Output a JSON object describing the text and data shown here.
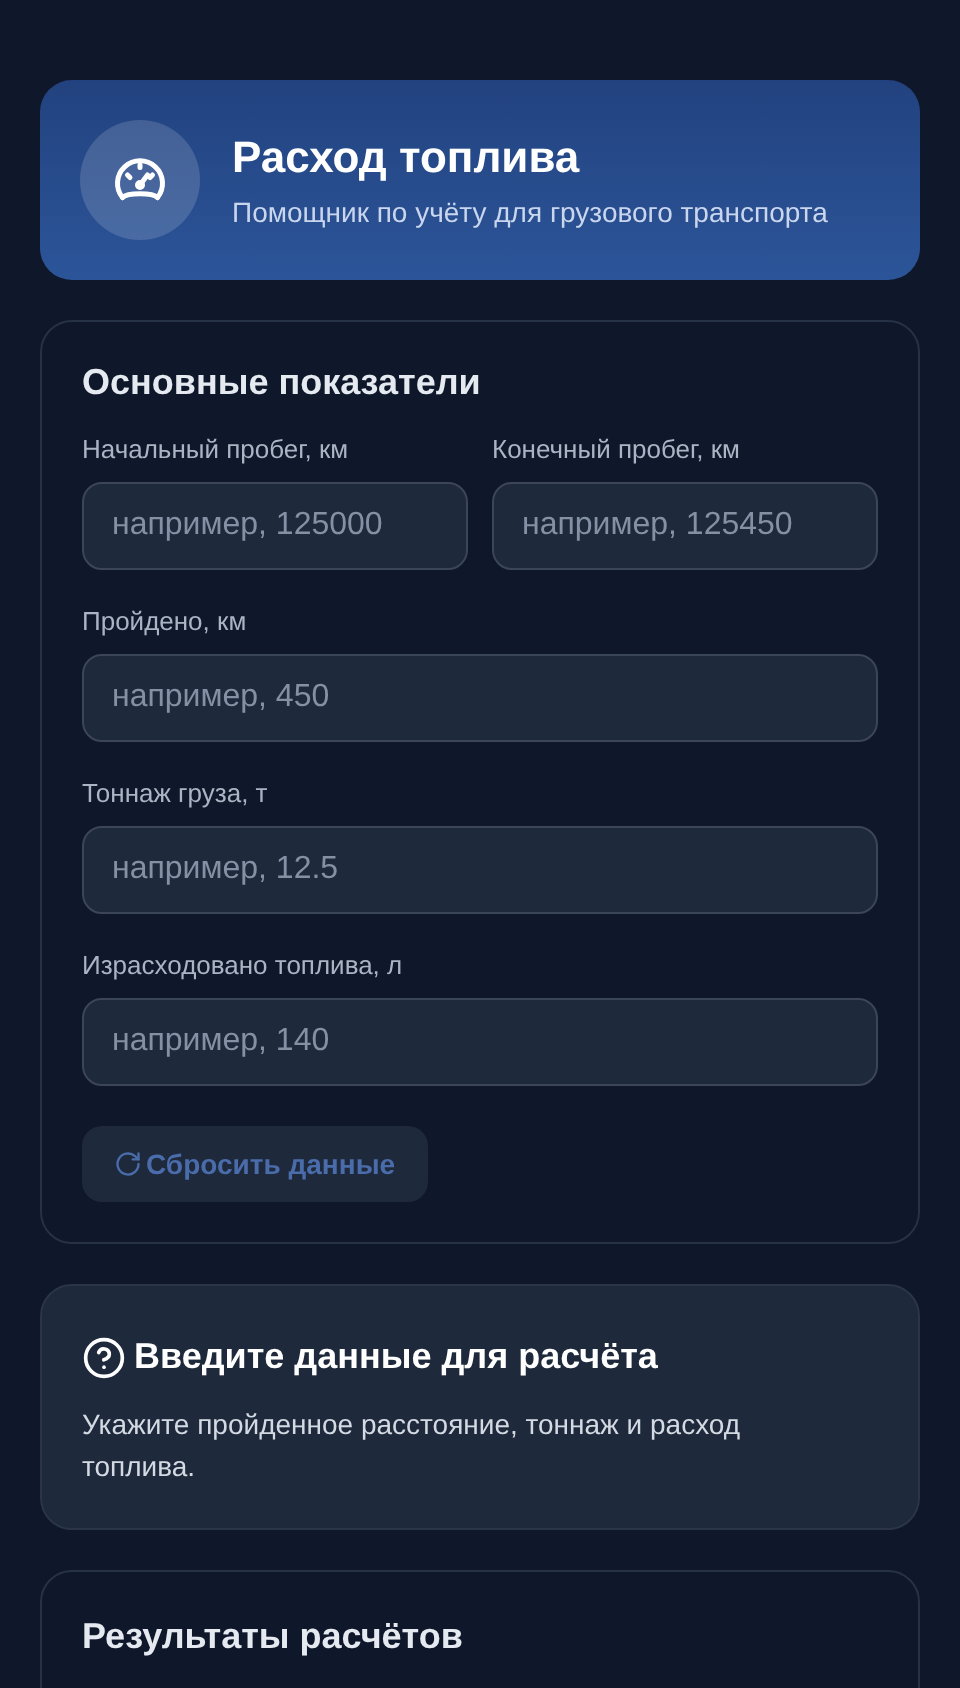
{
  "header": {
    "title": "Расход топлива",
    "subtitle": "Помощник по учёту для грузового транспорта"
  },
  "main_card": {
    "title": "Основные показатели",
    "field_rows": [
      [
        {
          "label": "Начальный пробег, км",
          "placeholder": "например, 125000"
        },
        {
          "label": "Конечный пробег, км",
          "placeholder": "например, 125450"
        }
      ],
      [
        {
          "label": "Пройдено, км",
          "placeholder": "например, 450"
        }
      ],
      [
        {
          "label": "Тоннаж груза, т",
          "placeholder": "например, 12.5"
        }
      ],
      [
        {
          "label": "Израсходовано топлива, л",
          "placeholder": "например, 140"
        }
      ]
    ],
    "reset_button": {
      "label": "Сбросить данные",
      "disabled": true
    }
  },
  "hint_card": {
    "title": "Введите данные для расчёта",
    "text": "Укажите пройденное расстояние, тоннаж и расход топлива."
  },
  "results_card": {
    "title": "Результаты расчётов"
  }
}
